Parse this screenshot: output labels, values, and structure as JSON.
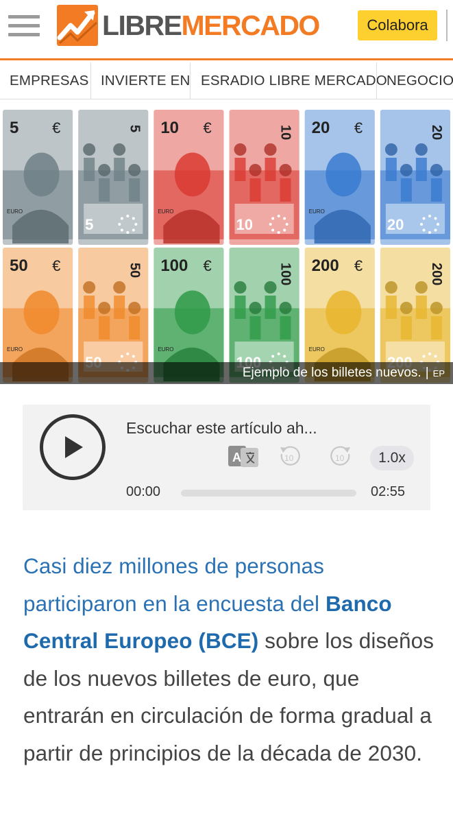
{
  "header": {
    "logo_part1": "LIBRE",
    "logo_part2": "MERCADO",
    "colabora_label": "Colabora",
    "menu_icon": "hamburger-menu-icon",
    "brand_color": "#f27b24",
    "button_color": "#fed02f"
  },
  "nav": {
    "items": [
      {
        "label": "EMPRESAS"
      },
      {
        "label": "INVIERTE EN"
      },
      {
        "label": "ESRADIO LIBRE MERCADO"
      },
      {
        "label": "NEGOCIOS"
      }
    ]
  },
  "hero": {
    "banknotes": [
      {
        "value": "5",
        "symbol": "€",
        "color": "#6e7f86"
      },
      {
        "value": "10",
        "symbol": "€",
        "color": "#d93b32"
      },
      {
        "value": "20",
        "symbol": "€",
        "color": "#3a7bd0"
      },
      {
        "value": "50",
        "symbol": "€",
        "color": "#f08a2b"
      },
      {
        "value": "100",
        "symbol": "€",
        "color": "#2f9a48"
      },
      {
        "value": "200",
        "symbol": "€",
        "color": "#e7b52e"
      }
    ],
    "note_label": "EURO",
    "caption": "Ejemplo de los billetes nuevos.",
    "caption_sep": "|",
    "credit": "EP"
  },
  "player": {
    "title": "Escuchar este artículo ah...",
    "current_time": "00:00",
    "total_time": "02:55",
    "speed": "1.0x",
    "progress": 0,
    "translate_glyph": "A",
    "rewind_seconds": "10",
    "forward_seconds": "10",
    "icons": [
      "play-icon",
      "translate-icon",
      "rewind-10-icon",
      "forward-10-icon"
    ]
  },
  "article": {
    "lead": "Casi diez millones de personas participaron en la encuesta del ",
    "link": "Banco Central Europeo (BCE)",
    "rest": " sobre los diseños de los nuevos billetes de euro, que entrarán en circulación de forma gradual a partir de principios de la década de 2030.",
    "lead_color": "#2b72b4",
    "link_color": "#1f6aad"
  }
}
